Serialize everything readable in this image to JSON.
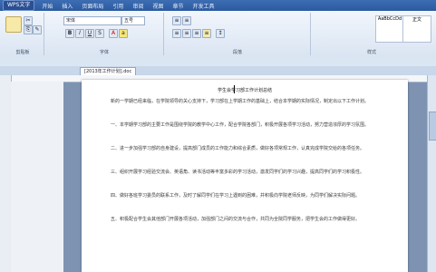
{
  "app": {
    "button_label": "WPS文字"
  },
  "menu": {
    "items": [
      "开始",
      "插入",
      "页面布局",
      "引用",
      "审阅",
      "视图",
      "章节",
      "开发工具"
    ]
  },
  "ribbon": {
    "font_name": "宋体",
    "font_size": "五号",
    "groups": [
      "剪贴板",
      "字体",
      "段落",
      "样式"
    ],
    "style_boxes": [
      "AaBbCcDd",
      "正文"
    ]
  },
  "tab": {
    "label": "[2013年工作计划].doc"
  },
  "document": {
    "title": "学生会学习部工作计划总结",
    "paragraphs": [
      "新的一学期已经来临，在学院领导的关心支持下，学习部在上学期工作的基础上，结合本学期的实际情况，制定出以下工作计划。",
      "一、本学期学习部的主要工作是围绕学院的教学中心工作，配合学院各部门，积极开展各项学习活动，努力营造浓厚的学习氛围。",
      "二、进一步加强学习部的自身建设，提高部门成员的工作能力和综合素质，做好各项常规工作，认真完成学院交给的各项任务。",
      "三、组织开展学习经验交流会、英语角、读书活动等丰富多彩的学习活动，激发同学们的学习兴趣，提高同学们的学习积极性。",
      "四、做好各班学习委员的联系工作，及时了解同学们在学习上遇到的困难，并积极向学院老师反映，为同学们解决实际问题。",
      "五、积极配合学生会其他部门开展各项活动，加强部门之间的交流与合作，共同为全院同学服务，把学生会的工作做得更好。"
    ]
  }
}
